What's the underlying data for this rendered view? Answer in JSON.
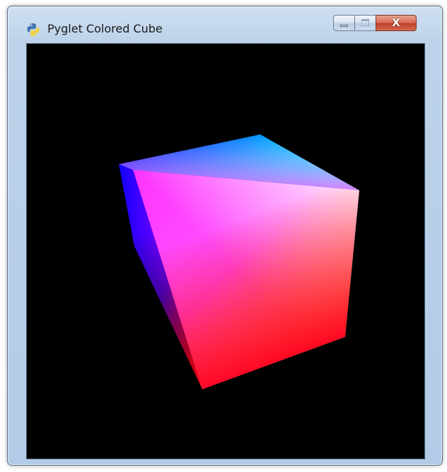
{
  "window": {
    "title": "Pyglet Colored Cube",
    "app_icon": "python-icon",
    "controls": {
      "minimize_icon": "minimize-icon",
      "maximize_icon": "maximize-icon",
      "close_icon": "close-icon",
      "close_glyph": "X"
    }
  },
  "scene": {
    "background": "#000000",
    "object": "cube",
    "vertex_colors": {
      "top_back_left": "#0000ff",
      "top_back_right": "#00ffff",
      "top_front_right": "#ffffff",
      "bottom_front_right": "#ffff00",
      "bottom_front_left": "#ff0000",
      "bottom_back_left": "#000000",
      "top_front_left": "#ff00ff"
    }
  }
}
